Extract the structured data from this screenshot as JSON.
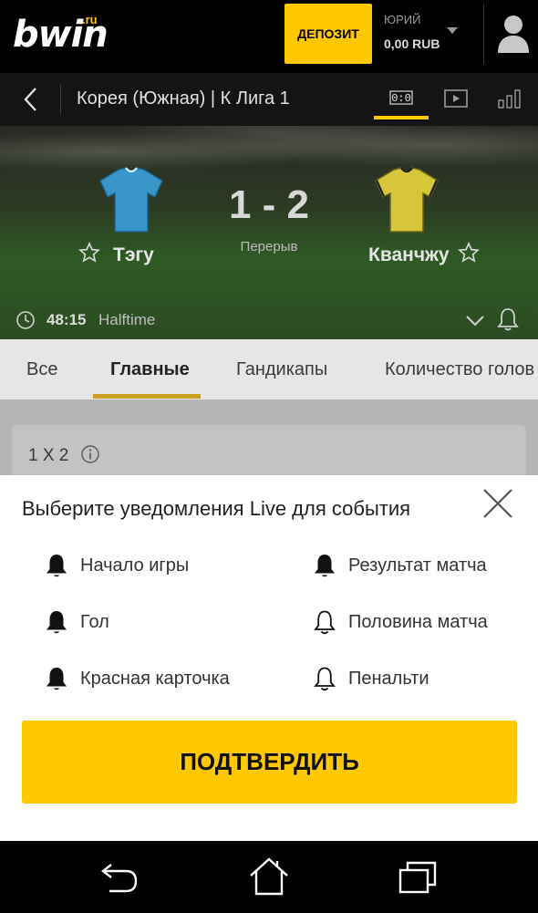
{
  "header": {
    "logo_text": "bwin",
    "logo_suffix": ".ru",
    "deposit_label": "ДЕПОЗИТ",
    "user_name": "ЮРИЙ",
    "balance": "0,00 RUB"
  },
  "subheader": {
    "title": "Корея (Южная) | К Лига 1",
    "score_tab_label": "0:0"
  },
  "scoreboard": {
    "home_team": "Тэгу",
    "away_team": "Кванчжу",
    "score": "1 - 2",
    "period": "Перерыв",
    "match_time": "48:15",
    "status": "Halftime",
    "colors": {
      "home_jersey": "#3a95c9",
      "away_jersey": "#d8c63a"
    }
  },
  "market_tabs": [
    {
      "label": "Все",
      "active": false
    },
    {
      "label": "Главные",
      "active": true
    },
    {
      "label": "Гандикапы",
      "active": false
    },
    {
      "label": "Количество голов",
      "active": false
    }
  ],
  "market": {
    "name": "1 X 2"
  },
  "sheet": {
    "title": "Выберите уведомления Live для события",
    "options": [
      {
        "label": "Начало игры",
        "enabled": true,
        "icon": "bell-filled-icon"
      },
      {
        "label": "Результат матча",
        "enabled": true,
        "icon": "bell-filled-icon"
      },
      {
        "label": "Гол",
        "enabled": true,
        "icon": "bell-filled-icon"
      },
      {
        "label": "Половина матча",
        "enabled": false,
        "icon": "bell-outline-icon"
      },
      {
        "label": "Красная карточка",
        "enabled": true,
        "icon": "bell-filled-icon"
      },
      {
        "label": "Пенальти",
        "enabled": false,
        "icon": "bell-outline-icon"
      }
    ],
    "confirm_label": "ПОДТВЕРДИТЬ"
  },
  "accent_color": "#ffc800"
}
